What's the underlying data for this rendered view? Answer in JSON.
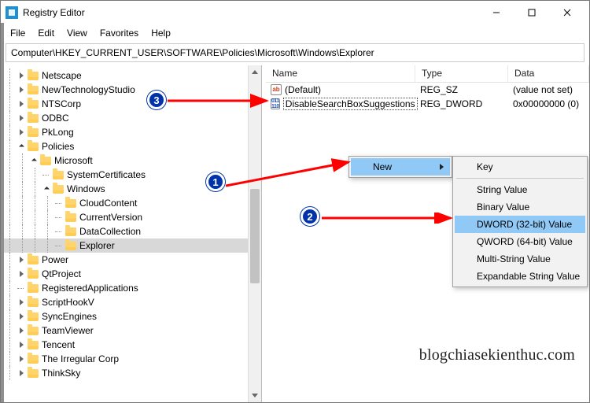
{
  "window": {
    "title": "Registry Editor",
    "min": "Minimize",
    "max": "Maximize",
    "close": "Close"
  },
  "menu": {
    "file": "File",
    "edit": "Edit",
    "view": "View",
    "favorites": "Favorites",
    "help": "Help"
  },
  "address": "Computer\\HKEY_CURRENT_USER\\SOFTWARE\\Policies\\Microsoft\\Windows\\Explorer",
  "tree": [
    {
      "level": 1,
      "chev": "right",
      "label": "Netscape"
    },
    {
      "level": 1,
      "chev": "right",
      "label": "NewTechnologyStudio"
    },
    {
      "level": 1,
      "chev": "right",
      "label": "NTSCorp"
    },
    {
      "level": 1,
      "chev": "right",
      "label": "ODBC"
    },
    {
      "level": 1,
      "chev": "right",
      "label": "PkLong"
    },
    {
      "level": 1,
      "chev": "down",
      "label": "Policies"
    },
    {
      "level": 2,
      "chev": "down",
      "label": "Microsoft"
    },
    {
      "level": 3,
      "chev": "",
      "label": "SystemCertificates"
    },
    {
      "level": 3,
      "chev": "down",
      "label": "Windows"
    },
    {
      "level": 4,
      "chev": "",
      "label": "CloudContent"
    },
    {
      "level": 4,
      "chev": "",
      "label": "CurrentVersion"
    },
    {
      "level": 4,
      "chev": "",
      "label": "DataCollection"
    },
    {
      "level": 4,
      "chev": "",
      "label": "Explorer",
      "selected": true
    },
    {
      "level": 1,
      "chev": "right",
      "label": "Power"
    },
    {
      "level": 1,
      "chev": "right",
      "label": "QtProject"
    },
    {
      "level": 1,
      "chev": "",
      "label": "RegisteredApplications"
    },
    {
      "level": 1,
      "chev": "right",
      "label": "ScriptHookV"
    },
    {
      "level": 1,
      "chev": "right",
      "label": "SyncEngines"
    },
    {
      "level": 1,
      "chev": "right",
      "label": "TeamViewer"
    },
    {
      "level": 1,
      "chev": "right",
      "label": "Tencent"
    },
    {
      "level": 1,
      "chev": "right",
      "label": "The Irregular Corp"
    },
    {
      "level": 1,
      "chev": "right",
      "label": "ThinkSky"
    }
  ],
  "list": {
    "headers": {
      "name": "Name",
      "type": "Type",
      "data": "Data"
    },
    "rows": [
      {
        "icon": "str",
        "name": "(Default)",
        "type": "REG_SZ",
        "data": "(value not set)",
        "editing": false
      },
      {
        "icon": "bin",
        "name": "DisableSearchBoxSuggestions",
        "type": "REG_DWORD",
        "data": "0x00000000 (0)",
        "editing": true
      }
    ]
  },
  "context": {
    "parent": [
      {
        "label": "New",
        "hl": true,
        "submenu": true
      }
    ],
    "sub": [
      "Key",
      "String Value",
      "Binary Value",
      "DWORD (32-bit) Value",
      "QWORD (64-bit) Value",
      "Multi-String Value",
      "Expandable String Value"
    ],
    "sub_hl_index": 3
  },
  "annotations": {
    "b1": "1",
    "b2": "2",
    "b3": "3"
  },
  "watermark": "blogchiasekienthuc.com"
}
